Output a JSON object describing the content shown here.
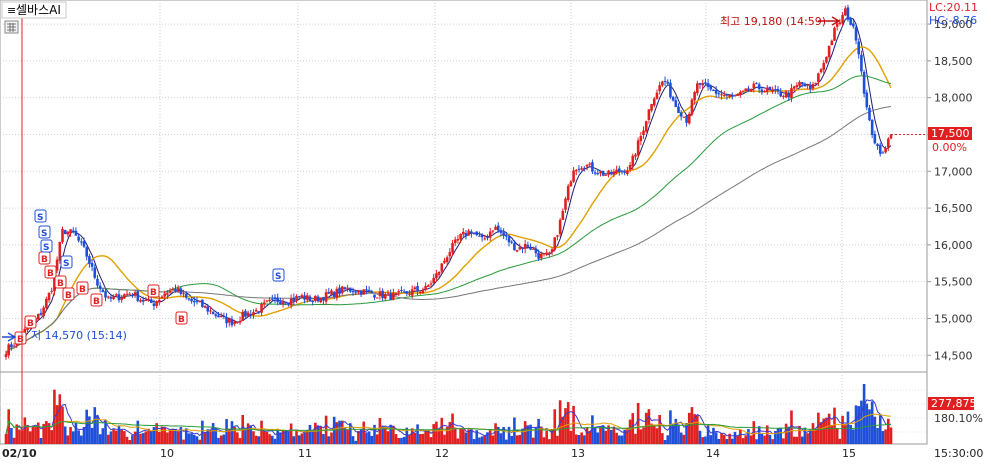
{
  "window": {
    "title": "셀바스AI"
  },
  "indicators": {
    "lc": "LC:20.11",
    "hc": "HC:-8.76"
  },
  "annotations": {
    "high_label": "최고 19,180 (14:59)",
    "low_label": "저 14,570 (15:14)"
  },
  "price_badge": {
    "price": "17,500",
    "change": "0.00%"
  },
  "volume_badge": {
    "volume": "277,875",
    "ratio": "180.10%"
  },
  "time_label": "15:30:00",
  "colors": {
    "up": "#e02020",
    "down": "#1f4fd8",
    "ma5": "#1c1c7a",
    "ma20": "#e0a000",
    "ma60": "#2a9a3a",
    "ma120": "#777777",
    "buy": "#e02020",
    "sell": "#1f4fd8"
  },
  "chart_data": {
    "type": "candlestick",
    "title": "셀바스AI",
    "y_ticks": [
      "19,000",
      "18,500",
      "18,000",
      "17,500",
      "17,000",
      "16,500",
      "16,000",
      "15,500",
      "15,000",
      "14,500"
    ],
    "ylim": [
      14300,
      19300
    ],
    "days": [
      "02/10",
      "10",
      "11",
      "12",
      "13",
      "14",
      "15"
    ],
    "high": {
      "price": 19180,
      "time": "14:59"
    },
    "low": {
      "price": 14570,
      "time": "15:14"
    },
    "last_price": 17500,
    "change_pct": "0.00%",
    "price_path": [
      14570,
      14700,
      14900,
      15050,
      15400,
      16200,
      16150,
      15900,
      15500,
      15250,
      15300,
      15350,
      15250,
      15200,
      15350,
      15400,
      15250,
      15200,
      15100,
      15000,
      14950,
      15050,
      15100,
      15200,
      15250,
      15250,
      15300,
      15250,
      15300,
      15350,
      15400,
      15380,
      15350,
      15320,
      15300,
      15330,
      15380,
      15400,
      15600,
      15900,
      16100,
      16200,
      16050,
      16250,
      16100,
      15950,
      16000,
      15850,
      15850,
      16400,
      17050,
      17100,
      17000,
      16950,
      17000,
      17050,
      17500,
      18000,
      18250,
      17900,
      17700,
      18200,
      18100,
      18050,
      18000,
      18050,
      18150,
      18100,
      18050,
      18050,
      18200,
      18100,
      18450,
      18900,
      19180,
      18800,
      17700,
      17200,
      17500
    ],
    "ma_names": [
      "5",
      "20",
      "60",
      "120"
    ],
    "buy_signal_label": "B",
    "sell_signal_label": "S",
    "volume": {
      "last": 277875,
      "ratio_pct": "180.10%"
    }
  }
}
